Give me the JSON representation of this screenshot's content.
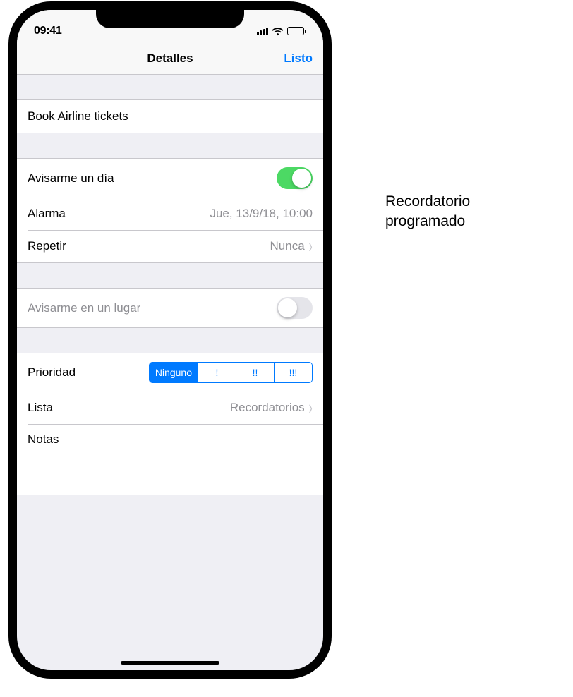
{
  "status": {
    "time": "09:41"
  },
  "nav": {
    "title": "Detalles",
    "done": "Listo"
  },
  "reminder": {
    "title": "Book Airline tickets"
  },
  "day_alert": {
    "label": "Avisarme un día",
    "on": true
  },
  "alarm": {
    "label": "Alarma",
    "value": "Jue, 13/9/18, 10:00"
  },
  "repeat": {
    "label": "Repetir",
    "value": "Nunca"
  },
  "location_alert": {
    "label": "Avisarme en un lugar",
    "on": false
  },
  "priority": {
    "label": "Prioridad",
    "options": [
      "Ninguno",
      "!",
      "!!",
      "!!!"
    ],
    "selected_index": 0
  },
  "list": {
    "label": "Lista",
    "value": "Recordatorios"
  },
  "notes": {
    "label": "Notas"
  },
  "callout": {
    "text_line1": "Recordatorio",
    "text_line2": "programado"
  }
}
